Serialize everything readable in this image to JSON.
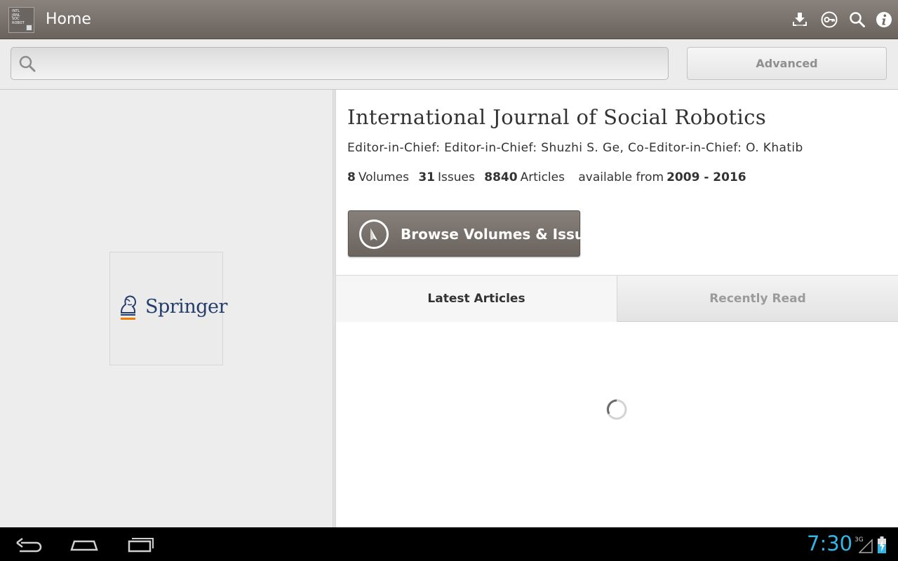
{
  "action_bar": {
    "app_icon_lines": [
      "INTL",
      "JRNL",
      "SOC",
      "ROBOT"
    ],
    "title": "Home",
    "icons": [
      "download-icon",
      "key-icon",
      "search-icon",
      "info-icon"
    ]
  },
  "search": {
    "value": "",
    "placeholder": "",
    "advanced_label": "Advanced"
  },
  "publisher": {
    "logo_text": "Springer"
  },
  "journal": {
    "title": "International Journal of Social Robotics",
    "editors": "Editor-in-Chief: Editor-in-Chief: Shuzhi S. Ge, Co-Editor-in-Chief: O. Khatib",
    "stats": {
      "volumes_count": "8",
      "volumes_label": "Volumes",
      "issues_count": "31",
      "issues_label": "Issues",
      "articles_count": "8840",
      "articles_label": "Articles",
      "available_label": "available from",
      "years": "2009 - 2016"
    },
    "browse_label": "Browse Volumes & Issues"
  },
  "tabs": [
    {
      "label": "Latest Articles",
      "selected": true
    },
    {
      "label": "Recently Read",
      "selected": false
    }
  ],
  "system_bar": {
    "time": "7:30",
    "network": "3G",
    "accent_color": "#33b5e5"
  }
}
